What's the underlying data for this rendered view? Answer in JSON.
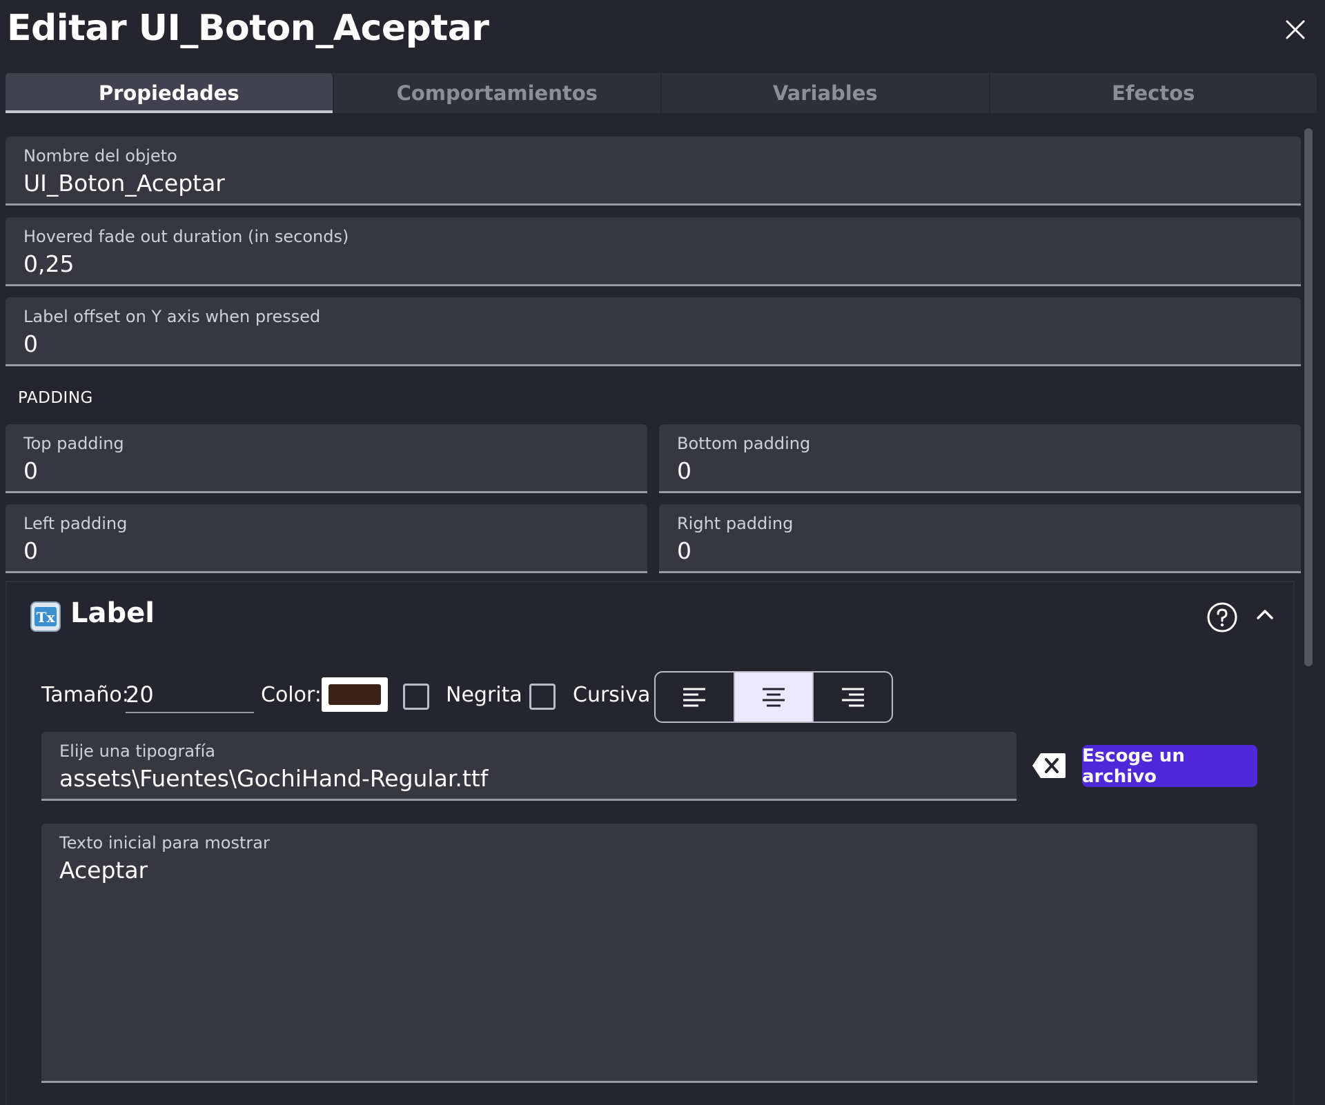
{
  "dialog": {
    "title": "Editar UI_Boton_Aceptar",
    "close_icon": "close-icon"
  },
  "tabs": [
    {
      "label": "Propiedades",
      "active": true
    },
    {
      "label": "Comportamientos",
      "active": false
    },
    {
      "label": "Variables",
      "active": false
    },
    {
      "label": "Efectos",
      "active": false
    }
  ],
  "properties": {
    "object_name": {
      "label": "Nombre del objeto",
      "value": "UI_Boton_Aceptar"
    },
    "hovered_fade": {
      "label": "Hovered fade out duration (in seconds)",
      "value": "0,25"
    },
    "label_offset": {
      "label": "Label offset on Y axis when pressed",
      "value": "0"
    }
  },
  "padding": {
    "heading": "PADDING",
    "top": {
      "label": "Top padding",
      "value": "0"
    },
    "bottom": {
      "label": "Bottom padding",
      "value": "0"
    },
    "left": {
      "label": "Left padding",
      "value": "0"
    },
    "right": {
      "label": "Right padding",
      "value": "0"
    }
  },
  "label_section": {
    "title": "Label",
    "icon": "text-object-icon",
    "size_label": "Tamaño:",
    "size_value": "20",
    "color_label": "Color:",
    "color_value": "#3b2417",
    "bold_label": "Negrita",
    "bold_checked": false,
    "italic_label": "Cursiva",
    "italic_checked": false,
    "alignment": [
      "left",
      "center",
      "right"
    ],
    "alignment_selected": "center",
    "font_field": {
      "label": "Elije una tipografía",
      "value": "assets\\Fuentes\\GochiHand-Regular.ttf"
    },
    "choose_file_label": "Escoge un archivo",
    "initial_text": {
      "label": "Texto inicial para mostrar",
      "value": "Aceptar"
    }
  },
  "colors": {
    "background": "#25252f",
    "field": "#373742",
    "accent": "#4f28d9",
    "selected_align": "#ece8ff"
  }
}
